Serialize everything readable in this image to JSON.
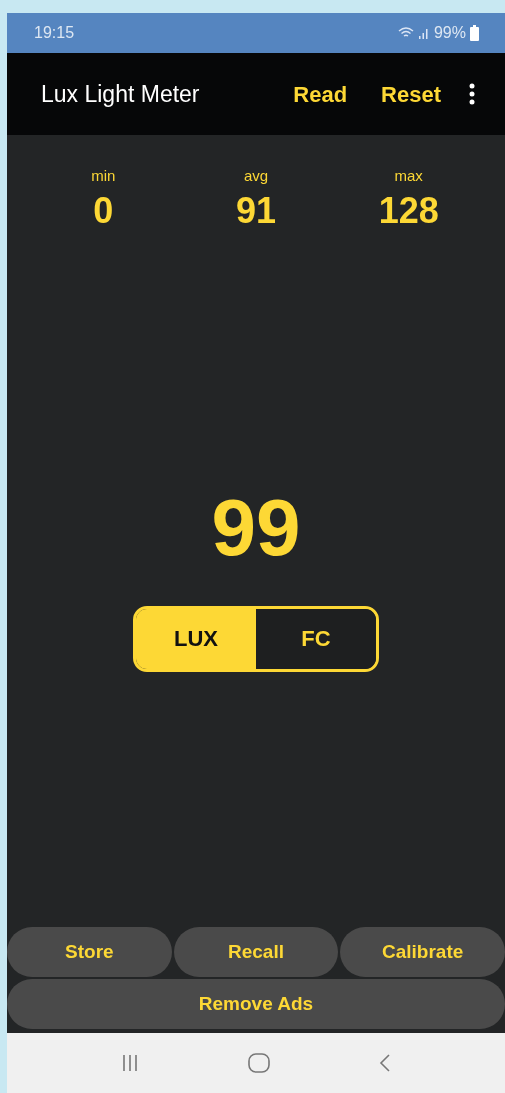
{
  "status_bar": {
    "time": "19:15",
    "battery": "99%"
  },
  "app_bar": {
    "title": "Lux Light Meter",
    "actions": [
      "Read",
      "Reset"
    ]
  },
  "stats": [
    {
      "label": "min",
      "value": "0"
    },
    {
      "label": "avg",
      "value": "91"
    },
    {
      "label": "max",
      "value": "128"
    }
  ],
  "reading": "99",
  "units": [
    {
      "label": "LUX",
      "selected": true
    },
    {
      "label": "FC",
      "selected": false
    }
  ],
  "buttons": [
    "Store",
    "Recall",
    "Calibrate"
  ],
  "wide_button": "Remove Ads"
}
